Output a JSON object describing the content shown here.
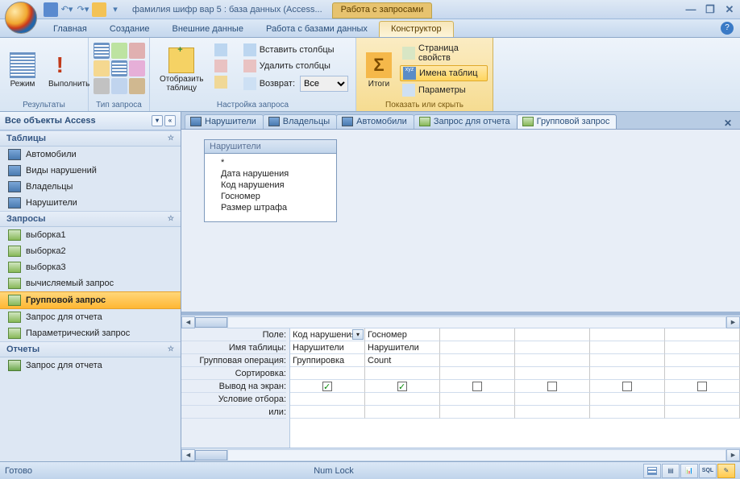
{
  "title": "фамилия шифр вар 5 : база данных (Access...",
  "context_tab": "Работа с запросами",
  "ribbon_tabs": [
    "Главная",
    "Создание",
    "Внешние данные",
    "Работа с базами данных",
    "Конструктор"
  ],
  "ribbon_active_idx": 4,
  "ribbon": {
    "g1": {
      "label": "Результаты",
      "mode": "Режим",
      "run": "Выполнить"
    },
    "g2": {
      "label": "Тип запроса"
    },
    "g3": {
      "label": "Настройка запроса",
      "show_table": "Отобразить\nтаблицу",
      "insert_cols": "Вставить столбцы",
      "delete_cols": "Удалить столбцы",
      "return": "Возврат:",
      "return_value": "Все"
    },
    "g4": {
      "label": "Показать или скрыть",
      "totals": "Итоги",
      "prop_page": "Страница свойств",
      "table_names": "Имена таблиц",
      "params": "Параметры"
    }
  },
  "nav": {
    "header": "Все объекты Access",
    "sections": [
      {
        "title": "Таблицы",
        "type": "table",
        "items": [
          "Автомобили",
          "Виды нарушений",
          "Владельцы",
          "Нарушители"
        ]
      },
      {
        "title": "Запросы",
        "type": "query",
        "items": [
          "выборка1",
          "выборка2",
          "выборка3",
          "вычисляемый запрос",
          "Групповой запрос",
          "Запрос для отчета",
          "Параметрический запрос"
        ],
        "selected": "Групповой запрос"
      },
      {
        "title": "Отчеты",
        "type": "report",
        "items": [
          "Запрос для отчета"
        ]
      }
    ]
  },
  "doc_tabs": [
    {
      "label": "Нарушители",
      "type": "table"
    },
    {
      "label": "Владельцы",
      "type": "table"
    },
    {
      "label": "Автомобили",
      "type": "table"
    },
    {
      "label": "Запрос для отчета",
      "type": "query"
    },
    {
      "label": "Групповой запрос",
      "type": "query",
      "active": true
    }
  ],
  "table_card": {
    "title": "Нарушители",
    "fields": [
      "*",
      "Дата нарушения",
      "Код нарушения",
      "Госномер",
      "Размер штрафа"
    ]
  },
  "grid": {
    "rows": [
      "Поле:",
      "Имя таблицы:",
      "Групповая операция:",
      "Сортировка:",
      "Вывод на экран:",
      "Условие отбора:",
      "или:"
    ],
    "cols": [
      {
        "field": "Код нарушения",
        "combo": true,
        "table": "Нарушители",
        "group": "Группировка",
        "show": true
      },
      {
        "field": "Госномер",
        "table": "Нарушители",
        "group": "Count",
        "show": true
      },
      {
        "field": "",
        "table": "",
        "group": "",
        "show": false
      },
      {
        "field": "",
        "table": "",
        "group": "",
        "show": false
      },
      {
        "field": "",
        "table": "",
        "group": "",
        "show": false
      },
      {
        "field": "",
        "table": "",
        "group": "",
        "show": false
      }
    ]
  },
  "status": {
    "ready": "Готово",
    "numlock": "Num Lock"
  }
}
